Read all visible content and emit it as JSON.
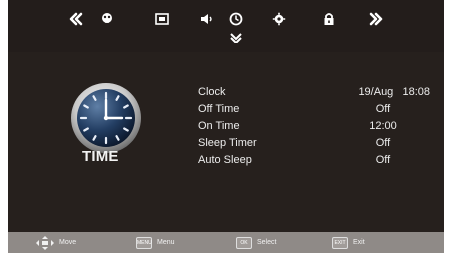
{
  "topbar": {
    "tabs": [
      {
        "name": "prev-icon"
      },
      {
        "name": "picture-icon"
      },
      {
        "name": "screen-icon"
      },
      {
        "name": "sound-icon"
      },
      {
        "name": "time-icon"
      },
      {
        "name": "setup-icon"
      },
      {
        "name": "lock-icon"
      },
      {
        "name": "next-icon"
      }
    ],
    "active_index": 4
  },
  "panel": {
    "title": "TIME",
    "rows": [
      {
        "label": "Clock",
        "value": "19/Aug   18:08"
      },
      {
        "label": "Off Time",
        "value": "Off"
      },
      {
        "label": "On Time",
        "value": "12:00"
      },
      {
        "label": "Sleep Timer",
        "value": "Off"
      },
      {
        "label": "Auto Sleep",
        "value": "Off"
      }
    ]
  },
  "footer": {
    "move": "Move",
    "menu": "Menu",
    "select": "Select",
    "exit": "Exit",
    "menu_key": "MENU",
    "select_key": "OK",
    "exit_key": "EXIT"
  },
  "colors": {
    "background": "#26201d",
    "footer": "#8f8a87",
    "text": "#ececec"
  }
}
